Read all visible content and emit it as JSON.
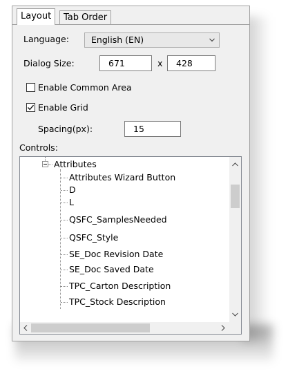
{
  "tabs": [
    {
      "label": "Layout",
      "active": true
    },
    {
      "label": "Tab Order",
      "active": false
    }
  ],
  "language": {
    "label": "Language:",
    "value": "English (EN)"
  },
  "dialog_size": {
    "label": "Dialog Size:",
    "width": "671",
    "separator": "x",
    "height": "428"
  },
  "common_area": {
    "label": "Enable Common Area",
    "checked": false
  },
  "grid": {
    "label": "Enable Grid",
    "checked": true
  },
  "spacing": {
    "label": "Spacing(px):",
    "value": "15"
  },
  "controls": {
    "label": "Controls:",
    "group": {
      "label": "Attributes",
      "expanded": true
    },
    "items": [
      "Attributes Wizard Button",
      "D",
      "L",
      "QSFC_SamplesNeeded",
      "QSFC_Style",
      "SE_Doc Revision Date",
      "SE_Doc Saved Date",
      "TPC_Carton Description",
      "TPC_Stock Description"
    ]
  },
  "icons": {
    "dropdown": "chevron-down-icon",
    "check": "check-icon",
    "collapse": "minus-box-icon",
    "scroll_up": "arrow-up-icon",
    "scroll_down": "arrow-down-icon",
    "scroll_left": "arrow-left-icon",
    "scroll_right": "arrow-right-icon"
  }
}
